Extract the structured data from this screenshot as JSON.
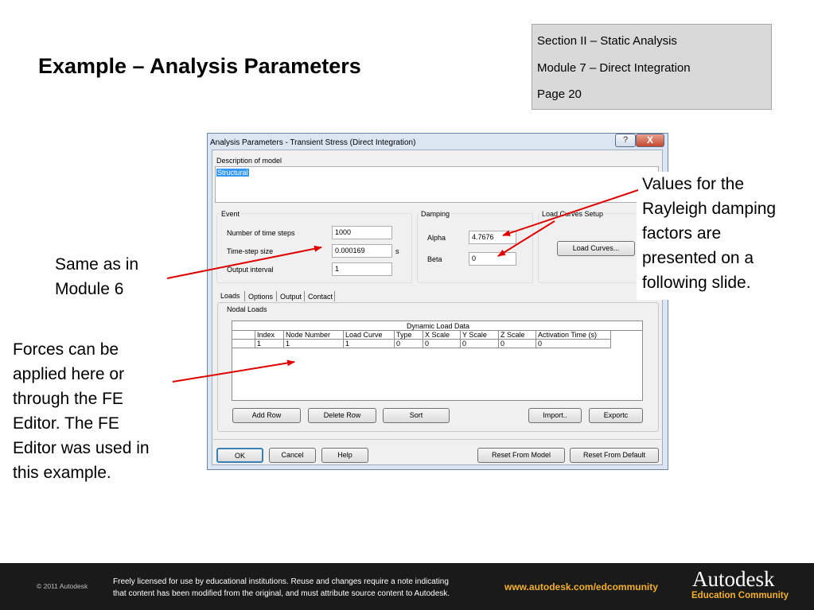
{
  "slide": {
    "title": "Example – Analysis Parameters",
    "section": [
      "Section II – Static Analysis",
      "Module 7 – Direct Integration",
      "Page 20"
    ],
    "callout_left1": [
      "Same as in",
      "Module 6"
    ],
    "callout_left2": [
      "Forces can be",
      "applied here or",
      "through the FE",
      "Editor.  The FE",
      "Editor was used in",
      "this example."
    ],
    "callout_right": [
      "Values for the",
      "Rayleigh damping",
      "factors are",
      "presented on a",
      "following slide."
    ]
  },
  "footer": {
    "copyright": "© 2011 Autodesk",
    "license_line1": "Freely licensed for use by educational institutions. Reuse and changes require a note indicating",
    "license_line2": "that content has been modified from the original, and must attribute source content to Autodesk.",
    "url": "www.autodesk.com/edcommunity",
    "brand": "Autodesk",
    "brand_sub": "Education Community"
  },
  "dialog": {
    "title": "Analysis Parameters - Transient Stress (Direct Integration)",
    "help_glyph": "?",
    "close_glyph": "X",
    "description_label": "Description of model",
    "description_value": "Structural",
    "event_label": "Event",
    "num_steps_label": "Number of time steps",
    "num_steps_value": "1000",
    "timestep_label": "Time-step size",
    "timestep_value": "0.000169",
    "timestep_unit": "s",
    "output_interval_label": "Output interval",
    "output_interval_value": "1",
    "damping_label": "Damping",
    "alpha_label": "Alpha",
    "alpha_value": "4.7676",
    "beta_label": "Beta",
    "beta_value": "0",
    "load_curves_setup_label": "Load Curves Setup",
    "load_curves_button": "Load Curves...",
    "tabs": [
      "Loads",
      "Options",
      "Output",
      "Contact"
    ],
    "nodal_loads_label": "Nodal Loads",
    "grid_title": "Dynamic Load Data",
    "grid_headers": [
      "Index",
      "Node Number",
      "Load Curve",
      "Type",
      "X Scale",
      "Y Scale",
      "Z Scale",
      "Activation Time (s)"
    ],
    "grid_row": [
      "1",
      "1",
      "1",
      "0",
      "0",
      "0",
      "0",
      "0"
    ],
    "add_row": "Add Row",
    "delete_row": "Delete Row",
    "sort": "Sort",
    "import": "Import..",
    "export": "Exportc",
    "ok": "OK",
    "cancel": "Cancel",
    "help": "Help",
    "reset_model": "Reset From Model",
    "reset_default": "Reset From Default"
  },
  "colors": {
    "footer_accent": "#f5b02a",
    "arrow": "#e00000",
    "selection": "#3399ff"
  }
}
